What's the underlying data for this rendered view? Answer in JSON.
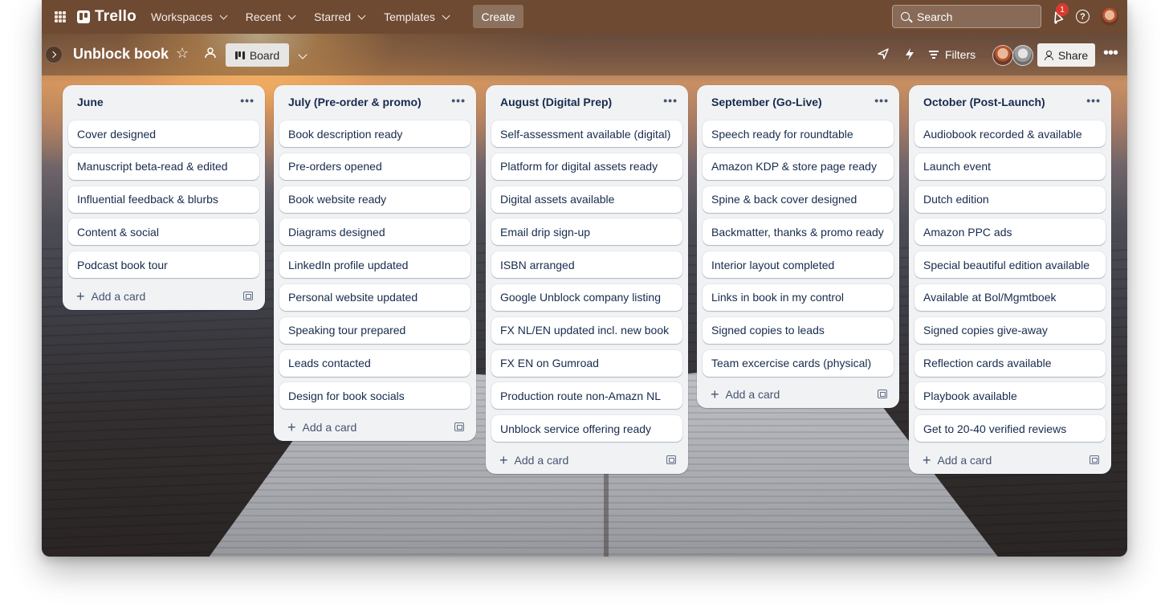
{
  "topnav": {
    "logo": "Trello",
    "menu": [
      {
        "label": "Workspaces"
      },
      {
        "label": "Recent"
      },
      {
        "label": "Starred"
      },
      {
        "label": "Templates"
      }
    ],
    "create_label": "Create",
    "search_placeholder": "Search",
    "notification_count": "1",
    "accent_color": "#6e4a32"
  },
  "boardbar": {
    "title": "Unblock book",
    "view_label": "Board",
    "filters_label": "Filters",
    "share_label": "Share"
  },
  "lists": [
    {
      "title": "June",
      "cards": [
        "Cover designed",
        "Manuscript beta-read & edited",
        "Influential feedback & blurbs",
        "Content & social",
        "Podcast book tour"
      ],
      "add_label": "Add a card"
    },
    {
      "title": "July (Pre-order & promo)",
      "cards": [
        "Book description ready",
        "Pre-orders opened",
        "Book website ready",
        "Diagrams designed",
        "LinkedIn profile updated",
        "Personal website updated",
        "Speaking tour prepared",
        "Leads contacted",
        "Design for book socials"
      ],
      "add_label": "Add a card"
    },
    {
      "title": "August (Digital Prep)",
      "cards": [
        "Self-assessment available (digital)",
        "Platform for digital assets ready",
        "Digital assets available",
        "Email drip sign-up",
        "ISBN arranged",
        "Google Unblock company listing",
        "FX NL/EN updated incl. new book",
        "FX EN on Gumroad",
        "Production route non-Amazn NL",
        "Unblock service offering ready"
      ],
      "add_label": "Add a card"
    },
    {
      "title": "September (Go-Live)",
      "cards": [
        "Speech ready for roundtable",
        "Amazon KDP & store page ready",
        "Spine & back cover designed",
        "Backmatter, thanks & promo ready",
        "Interior layout completed",
        "Links in book in my control",
        "Signed copies to leads",
        "Team excercise cards (physical)"
      ],
      "add_label": "Add a card"
    },
    {
      "title": "October (Post-Launch)",
      "cards": [
        "Audiobook recorded & available",
        "Launch event",
        "Dutch edition",
        "Amazon PPC ads",
        "Special beautiful edition available",
        "Available at Bol/Mgmtboek",
        "Signed copies give-away",
        "Reflection cards available",
        "Playbook available",
        "Get to 20-40 verified reviews"
      ],
      "add_label": "Add a card"
    }
  ]
}
